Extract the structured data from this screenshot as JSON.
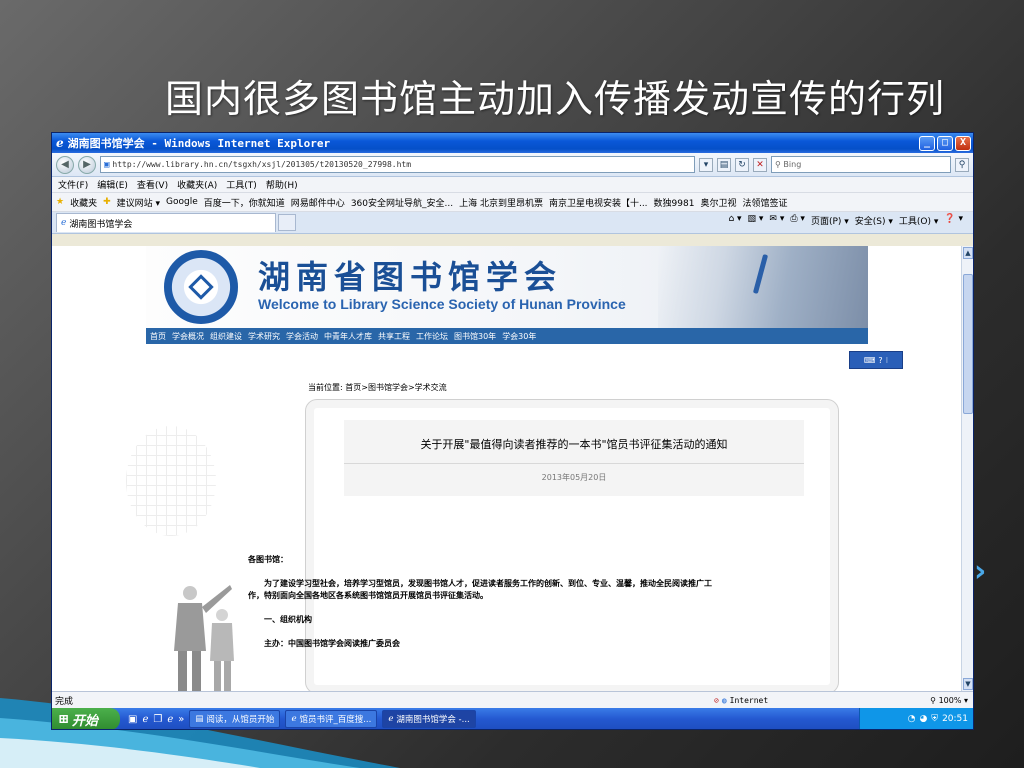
{
  "slide": {
    "title": "国内很多图书馆主动加入传播发动宣传的行列"
  },
  "window": {
    "title": "湖南图书馆学会 - Windows Internet Explorer",
    "min": "_",
    "max": "□",
    "close": "X"
  },
  "addressbar": {
    "url": "http://www.library.hn.cn/tsgxh/xsjl/201305/t20130520_27998.htm",
    "search_placeholder": "Bing"
  },
  "menubar": [
    "文件(F)",
    "编辑(E)",
    "查看(V)",
    "收藏夹(A)",
    "工具(T)",
    "帮助(H)"
  ],
  "favorites": {
    "label": "收藏夹",
    "items": [
      "建议网站 ▾",
      "Google",
      "百度一下，你就知道",
      "网易邮件中心",
      "360安全网址导航_安全...",
      "上海 北京到里昂机票",
      "南京卫星电视安装【十...",
      "数独9981",
      "奥尔卫视",
      "法领馆签证"
    ]
  },
  "tab": {
    "label": "湖南图书馆学会"
  },
  "commandbar": [
    "页面(P) ▾",
    "安全(S) ▾",
    "工具(O) ▾"
  ],
  "site": {
    "name": "湖南省图书馆学会",
    "subtitle": "Welcome to  Library Science Society of Hunan Province",
    "nav": [
      "首页",
      "学会概况",
      "组织建设",
      "学术研究",
      "学会活动",
      "中青年人才库",
      "共享工程",
      "工作论坛",
      "图书馆30年",
      "学会30年"
    ]
  },
  "article": {
    "breadcrumb": "当前位置: 首页>图书馆学会>学术交流",
    "title": "关于开展\"最值得向读者推荐的一本书\"馆员书评征集活动的通知",
    "date": "2013年05月20日",
    "salutation": "各图书馆：",
    "paragraph1": "为了建设学习型社会，培养学习型馆员，发现图书馆人才，促进读者服务工作的创新、到位、专业、温馨，推动全民阅读推广工作，特别面向全国各地区各系统图书馆馆员开展馆员书评征集活动。",
    "section1": "一、组织机构",
    "organizer": "主办：中国图书馆学会阅读推广委员会"
  },
  "statusbar": {
    "left": "完成",
    "zone": "Internet",
    "zoom": "100%"
  },
  "taskbar": {
    "start": "开始",
    "items": [
      "阅读，从馆员开始",
      "馆员书评_百度搜...",
      "湖南图书馆学会 -..."
    ],
    "clock": "20:51"
  },
  "colors": {
    "accent": "#2966a8",
    "site_blue": "#1a4f96",
    "taskbar": "#2458d0"
  }
}
